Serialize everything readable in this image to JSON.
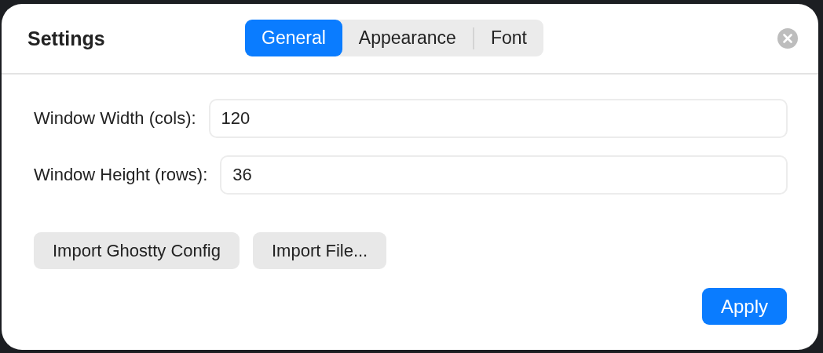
{
  "window": {
    "title": "Settings"
  },
  "tabs": [
    {
      "label": "General",
      "selected": true
    },
    {
      "label": "Appearance",
      "selected": false
    },
    {
      "label": "Font",
      "selected": false
    }
  ],
  "fields": [
    {
      "label": "Window Width (cols):",
      "value": "120"
    },
    {
      "label": "Window Height (rows):",
      "value": "36"
    }
  ],
  "import_buttons": [
    "Import Ghostty Config",
    "Import File..."
  ],
  "apply_button": "Apply"
}
